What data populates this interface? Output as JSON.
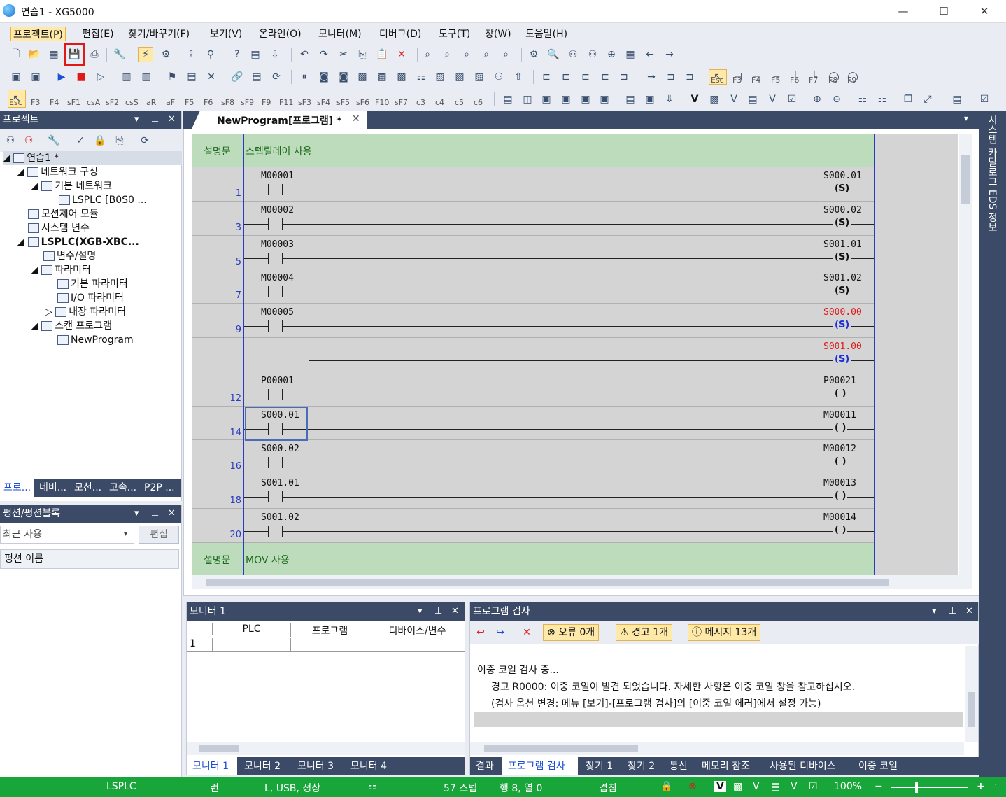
{
  "window": {
    "title": "연습1 - XG5000",
    "minimize": "—",
    "maximize": "☐",
    "close": "✕"
  },
  "menu": [
    "프로젝트(P)",
    "편집(E)",
    "찾기/바꾸기(F)",
    "보기(V)",
    "온라인(O)",
    "모니터(M)",
    "디버그(D)",
    "도구(T)",
    "창(W)",
    "도움말(H)"
  ],
  "toolbar3_labels": [
    "Esc",
    "F3",
    "F4",
    "sF1",
    "csA",
    "sF2",
    "csS",
    "aR",
    "aF",
    "F5",
    "F6",
    "sF8",
    "sF9",
    "F9",
    "F11",
    "sF3",
    "sF4",
    "sF5",
    "sF6",
    "F10",
    "sF7",
    "c3",
    "c4",
    "c5",
    "c6"
  ],
  "toolbar2_labels": [
    "Esc",
    "F3",
    "F4",
    "F5",
    "F6",
    "F7",
    "F8",
    "F9"
  ],
  "project_panel": {
    "title": "프로젝트",
    "tree": [
      {
        "label": "연습1 *",
        "level": 0,
        "bold": false
      },
      {
        "label": "네트워크 구성",
        "level": 1,
        "bold": false
      },
      {
        "label": "기본 네트워크",
        "level": 2,
        "bold": false
      },
      {
        "label": "LSPLC [B0S0 ...",
        "level": 3,
        "bold": false
      },
      {
        "label": "모션제어 모듈",
        "level": 1,
        "bold": false
      },
      {
        "label": "시스템 변수",
        "level": 1,
        "bold": false
      },
      {
        "label": "LSPLC(XGB-XBC...",
        "level": 1,
        "bold": true
      },
      {
        "label": "변수/설명",
        "level": 2,
        "bold": false
      },
      {
        "label": "파라미터",
        "level": 2,
        "bold": false
      },
      {
        "label": "기본 파라미터",
        "level": 3,
        "bold": false
      },
      {
        "label": "I/O 파라미터",
        "level": 3,
        "bold": false
      },
      {
        "label": "내장 파라미터",
        "level": 3,
        "bold": false
      },
      {
        "label": "스캔 프로그램",
        "level": 2,
        "bold": false
      },
      {
        "label": "NewProgram",
        "level": 3,
        "bold": false
      }
    ],
    "tabs": [
      "프로...",
      "네비...",
      "모션...",
      "고속...",
      "P2P ..."
    ]
  },
  "function_panel": {
    "title": "펑션/펑션블록",
    "recent": "최근 사용",
    "edit": "편집",
    "col": "펑션 이름"
  },
  "editor": {
    "tab": "NewProgram[프로그램] *",
    "comment1": {
      "label": "설명문",
      "text": "스텝릴레이 사용"
    },
    "comment2": {
      "label": "설명문",
      "text": "MOV 사용"
    },
    "rungs": [
      {
        "num": "1",
        "contact": "M00001",
        "coil": "S000.01",
        "ctype": "S"
      },
      {
        "num": "3",
        "contact": "M00002",
        "coil": "S000.02",
        "ctype": "S"
      },
      {
        "num": "5",
        "contact": "M00003",
        "coil": "S001.01",
        "ctype": "S"
      },
      {
        "num": "7",
        "contact": "M00004",
        "coil": "S001.02",
        "ctype": "S"
      },
      {
        "num": "9",
        "contact": "M00005",
        "coil": "S000.00",
        "ctype": "S-red"
      },
      {
        "num": "",
        "contact": "",
        "coil": "S001.00",
        "ctype": "S-red"
      },
      {
        "num": "12",
        "contact": "P00001",
        "coil": "P00021",
        "ctype": "O"
      },
      {
        "num": "14",
        "contact": "S000.01",
        "coil": "M00011",
        "ctype": "O"
      },
      {
        "num": "16",
        "contact": "S000.02",
        "coil": "M00012",
        "ctype": "O"
      },
      {
        "num": "18",
        "contact": "S001.01",
        "coil": "M00013",
        "ctype": "O"
      },
      {
        "num": "20",
        "contact": "S001.02",
        "coil": "M00014",
        "ctype": "O"
      }
    ]
  },
  "right_dock": {
    "label": "시스템 카탈로그   EDS 정보"
  },
  "monitor_panel": {
    "title": "모니터 1",
    "columns": [
      "PLC",
      "프로그램",
      "디바이스/변수"
    ],
    "row1": "1",
    "tabs": [
      "모니터 1",
      "모니터 2",
      "모니터 3",
      "모니터 4"
    ]
  },
  "check_panel": {
    "title": "프로그램 검사",
    "errors": "오류 0개",
    "warnings": "경고 1개",
    "messages": "메시지 13개",
    "lines": [
      "이중 코일 검사 중...",
      "경고 R0000: 이중 코일이 발견 되었습니다. 자세한 사항은 이중 코일 창을 참고하십시오.",
      "(검사 옵션 변경: 메뉴 [보기]-[프로그램 검사]의 [이중 코일 에러]에서 설정 가능)"
    ],
    "tabs": [
      "결과",
      "프로그램 검사",
      "찾기 1",
      "찾기 2",
      "통신",
      "메모리 참조",
      "사용된 디바이스",
      "이중 코일"
    ]
  },
  "status": {
    "plc": "LSPLC",
    "mode": "런",
    "conn": "L, USB, 정상",
    "steps": "57 스텝",
    "pos": "행 8, 열 0",
    "overwrite": "겹침",
    "zoom": "100%",
    "minus": "−",
    "plus": "+"
  },
  "colors": {
    "panel_header": "#3b4a66",
    "status": "#18a53a",
    "comment_bg": "#bcdcbc",
    "ladder_bg": "#d4d4d4",
    "rail": "#2b3dbf"
  }
}
